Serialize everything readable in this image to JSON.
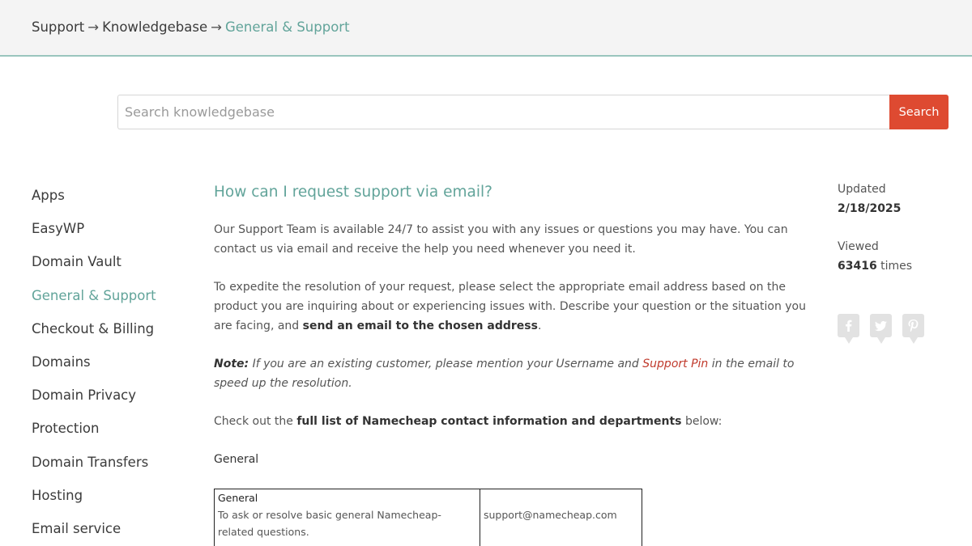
{
  "breadcrumb": {
    "items": [
      "Support",
      "Knowledgebase",
      "General & Support"
    ],
    "separator": "→"
  },
  "search": {
    "placeholder": "Search knowledgebase",
    "value": "",
    "button_label": "Search"
  },
  "sidebar": {
    "items": [
      {
        "label": "Apps"
      },
      {
        "label": "EasyWP"
      },
      {
        "label": "Domain Vault"
      },
      {
        "label": "General & Support",
        "active": true
      },
      {
        "label": "Checkout & Billing"
      },
      {
        "label": "Domains"
      },
      {
        "label": "Domain Privacy"
      },
      {
        "label": "Protection"
      },
      {
        "label": "Domain Transfers"
      },
      {
        "label": "Hosting"
      },
      {
        "label": "Email service"
      }
    ]
  },
  "article": {
    "title": "How can I request support via email?",
    "p1": "Our Support Team is available 24/7 to assist you with any issues or questions you may have. You can contact us via email and receive the help you need whenever you need it.",
    "p2_text": "To expedite the resolution of your request, please select the appropriate email address based on the product you are inquiring about or experiencing issues with. Describe your question or the situation you are facing, and ",
    "p2_bold": "send an email to the chosen address",
    "p2_end": ".",
    "note_label": "Note:",
    "note_text1": " If you are an existing customer, please mention your Username and ",
    "note_link": "Support Pin",
    "note_text2": " in the email to speed up the resolution.",
    "p4_text": "Check out the ",
    "p4_bold": "full list of Namecheap contact information and departments",
    "p4_end": " below:",
    "section_heading": "General",
    "table": {
      "row1_title": "General",
      "row1_desc": "To ask or resolve basic general Namecheap-related questions.",
      "row1_email": "support@namecheap.com"
    }
  },
  "meta": {
    "updated_label": "Updated",
    "updated_value": "2/18/2025",
    "viewed_label": "Viewed",
    "viewed_count": "63416",
    "viewed_suffix": " times"
  },
  "social": {
    "icons": [
      "facebook-icon",
      "twitter-icon",
      "pinterest-icon"
    ],
    "color": "#e2e2e2"
  },
  "colors": {
    "accent": "#62a49a",
    "search_button": "#de4a31",
    "link_red": "#c0392b"
  }
}
